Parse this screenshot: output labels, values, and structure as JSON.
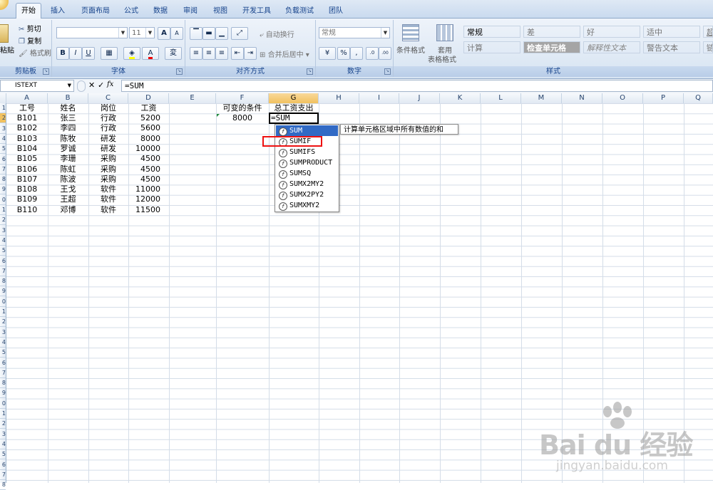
{
  "ribbon": {
    "tabs": [
      "开始",
      "插入",
      "页面布局",
      "公式",
      "数据",
      "审阅",
      "视图",
      "开发工具",
      "负载测试",
      "团队"
    ],
    "active_tab": "开始",
    "clipboard": {
      "paste": "粘贴",
      "cut": "剪切",
      "copy": "复制",
      "format_painter": "格式刷",
      "label": "剪贴板"
    },
    "font": {
      "name": "",
      "size": "11",
      "label": "字体",
      "bold": "B",
      "italic": "I",
      "underline": "U",
      "grow": "A",
      "shrink": "A",
      "color": "A",
      "phonetic": "変"
    },
    "alignment": {
      "wrap": "自动换行",
      "merge": "合并后居中",
      "label": "对齐方式"
    },
    "number": {
      "format": "常规",
      "label": "数字",
      "percent": "%",
      "comma": ",",
      "inc_decimal": ".0",
      "dec_decimal": ".00"
    },
    "styles": {
      "conditional": "条件格式",
      "table_line1": "套用",
      "table_line2": "表格格式",
      "label": "样式",
      "row1": [
        "常规",
        "差",
        "好",
        "适中",
        "超"
      ],
      "row2": [
        "计算",
        "检查单元格",
        "解释性文本",
        "警告文本",
        "链"
      ]
    }
  },
  "formula_bar": {
    "name_box": "ISTEXT",
    "cancel": "✕",
    "enter": "✓",
    "fx": "fx",
    "value": "=SUM"
  },
  "columns": [
    "A",
    "B",
    "C",
    "D",
    "E",
    "F",
    "G",
    "H",
    "I",
    "J",
    "K",
    "L",
    "M",
    "N",
    "O",
    "P",
    "Q"
  ],
  "selected_column": "G",
  "headers": {
    "a": "工号",
    "b": "姓名",
    "c": "岗位",
    "d": "工资",
    "f": "可变的条件",
    "g": "总工资支出"
  },
  "rows": [
    {
      "id": "B101",
      "name": "张三",
      "dept": "行政",
      "salary": "5200"
    },
    {
      "id": "B102",
      "name": "李四",
      "dept": "行政",
      "salary": "5600"
    },
    {
      "id": "B103",
      "name": "陈牧",
      "dept": "研发",
      "salary": "8000"
    },
    {
      "id": "B104",
      "name": "罗诚",
      "dept": "研发",
      "salary": "10000"
    },
    {
      "id": "B105",
      "name": "李珊",
      "dept": "采购",
      "salary": "4500"
    },
    {
      "id": "B106",
      "name": "陈虹",
      "dept": "采购",
      "salary": "4500"
    },
    {
      "id": "B107",
      "name": "陈波",
      "dept": "采购",
      "salary": "4500"
    },
    {
      "id": "B108",
      "name": "王戈",
      "dept": "软件",
      "salary": "11000"
    },
    {
      "id": "B109",
      "name": "王超",
      "dept": "软件",
      "salary": "12000"
    },
    {
      "id": "B110",
      "name": "邓博",
      "dept": "软件",
      "salary": "11500"
    }
  ],
  "condition_value": "8000",
  "active_cell_text": "=SUM",
  "autocomplete": [
    "SUM",
    "SUMIF",
    "SUMIFS",
    "SUMPRODUCT",
    "SUMSQ",
    "SUMX2MY2",
    "SUMX2PY2",
    "SUMXMY2"
  ],
  "autocomplete_highlight": "SUM",
  "tooltip": "计算单元格区域中所有数值的和",
  "watermark": {
    "brand": "Bai du 经验",
    "url": "jingyan.baidu.com"
  }
}
